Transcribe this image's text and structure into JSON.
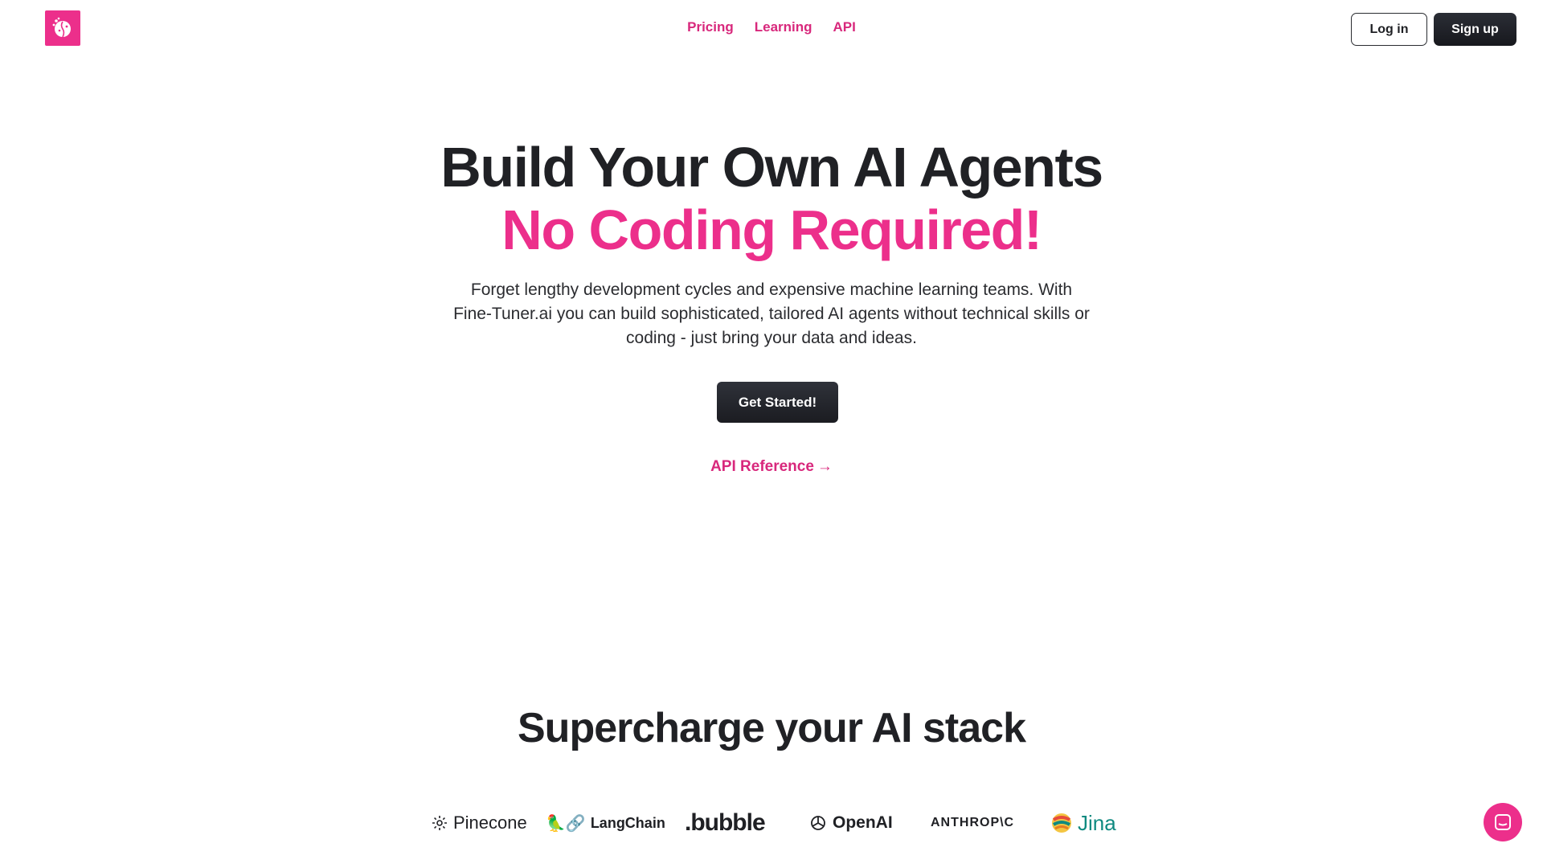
{
  "nav": {
    "logo_icon": "brain-icon",
    "links": [
      "Pricing",
      "Learning",
      "API"
    ],
    "login_label": "Log in",
    "signup_label": "Sign up"
  },
  "hero": {
    "title_line1": "Build Your Own AI Agents",
    "title_line2": "No Coding Required!",
    "description": "Forget lengthy development cycles and expensive machine learning teams. With Fine-Tuner.ai you can build sophisticated, tailored AI agents without technical skills or coding - just bring your data and ideas.",
    "cta_label": "Get Started!",
    "api_reference_label": "API Reference"
  },
  "stack": {
    "title": "Supercharge your AI stack",
    "brands": [
      {
        "name": "Pinecone",
        "icon": "pinecone-icon"
      },
      {
        "name": "LangChain",
        "icon": "langchain-icon"
      },
      {
        "name": ".bubble",
        "icon": ""
      },
      {
        "name": "OpenAI",
        "icon": "openai-icon"
      },
      {
        "name": "ANTHROP\\C",
        "icon": ""
      },
      {
        "name": "Jina",
        "icon": "jina-icon"
      }
    ]
  },
  "colors": {
    "accent": "#ec2f8b",
    "dark": "#1f2024"
  },
  "chat": {
    "icon": "chat-icon"
  }
}
